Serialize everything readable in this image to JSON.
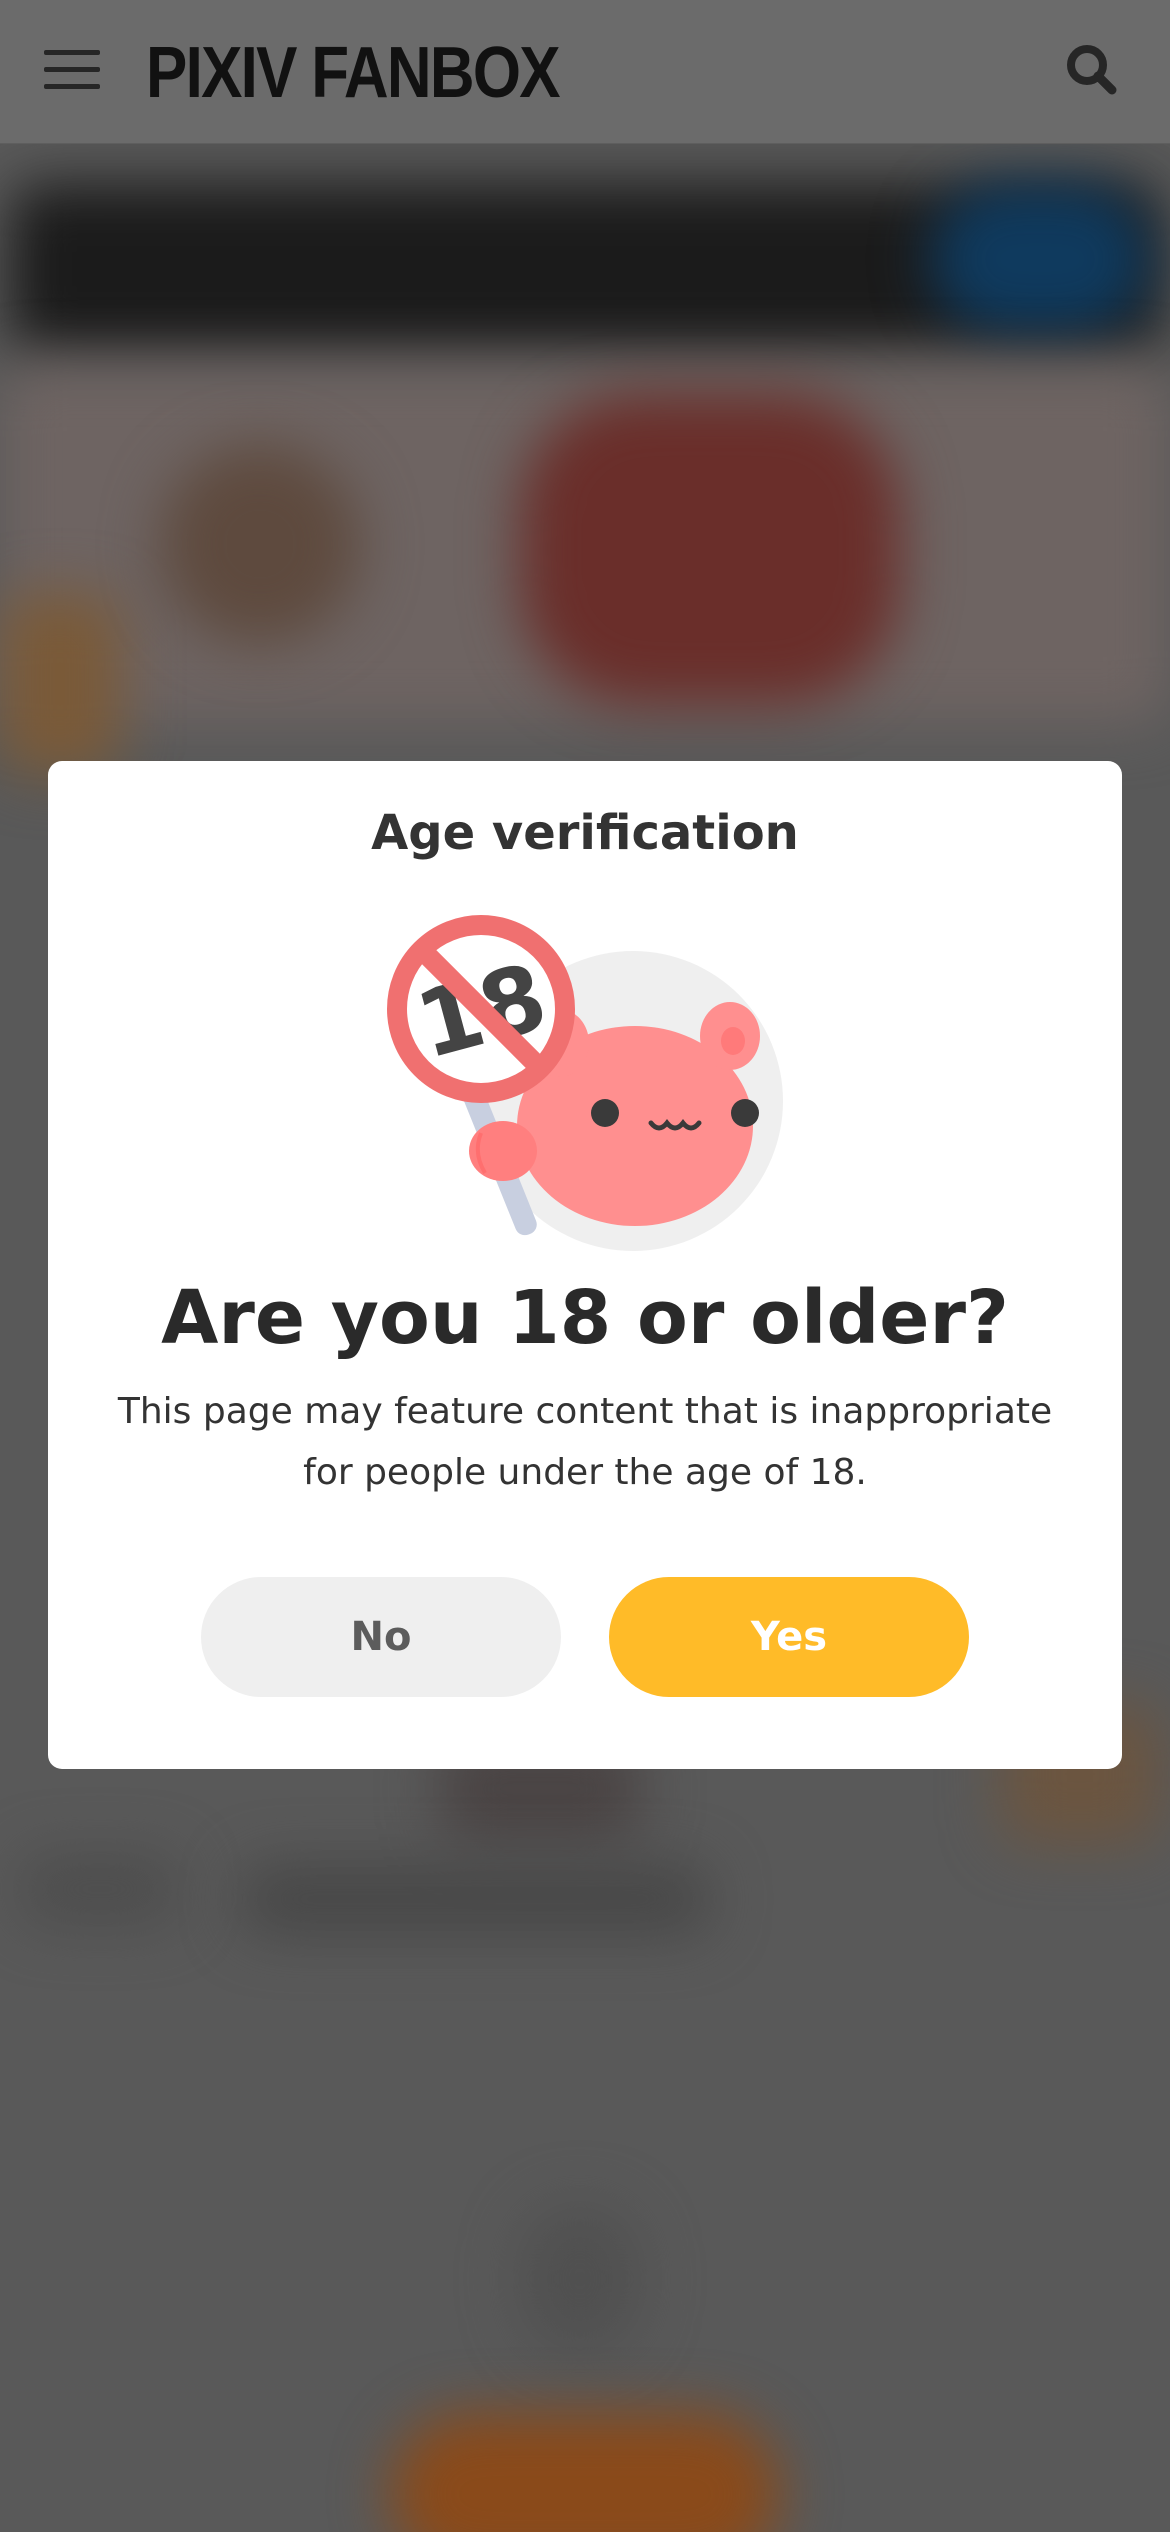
{
  "header": {
    "logo_text": "PIXIV FANBOX",
    "menu_icon": "hamburger-menu-icon",
    "search_icon": "search-icon"
  },
  "modal": {
    "title": "Age verification",
    "illustration_icon": "age-restriction-18-mascot-icon",
    "question": "Are you 18 or older?",
    "description": "This page may feature content that is inappropriate for people under the age of 18.",
    "no_label": "No",
    "yes_label": "Yes"
  },
  "colors": {
    "overlay": "#595959",
    "modal_bg": "#ffffff",
    "yes_button": "#ffbb28",
    "no_button": "#efefef",
    "mascot_pink": "#ff8f8f",
    "prohibition_red": "#f07070"
  }
}
